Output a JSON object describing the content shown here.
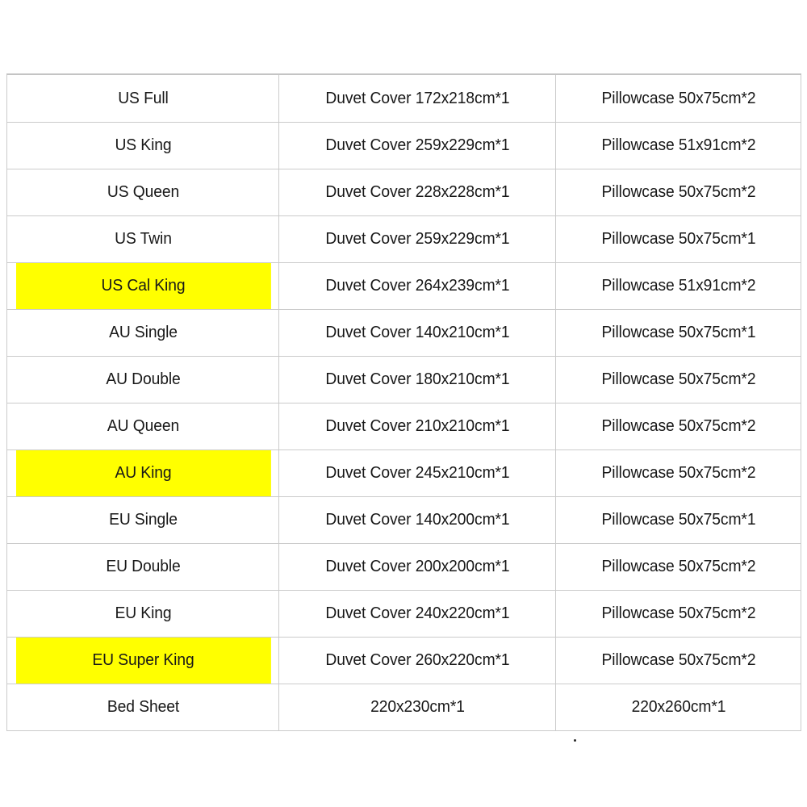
{
  "table": {
    "name": "bedding-size-chart",
    "highlight_color": "#ffff00",
    "border_color": "#cbcbcb",
    "text_color": "#181818",
    "columns": [
      "size",
      "duvet_cover",
      "pillowcase"
    ],
    "rows": [
      {
        "size": "US Full",
        "duvet_cover": "Duvet Cover 172x218cm*1",
        "pillowcase": "Pillowcase 50x75cm*2",
        "highlighted": false
      },
      {
        "size": "US King",
        "duvet_cover": "Duvet Cover 259x229cm*1",
        "pillowcase": "Pillowcase 51x91cm*2",
        "highlighted": false
      },
      {
        "size": "US Queen",
        "duvet_cover": "Duvet Cover 228x228cm*1",
        "pillowcase": "Pillowcase 50x75cm*2",
        "highlighted": false
      },
      {
        "size": "US Twin",
        "duvet_cover": "Duvet Cover 259x229cm*1",
        "pillowcase": "Pillowcase 50x75cm*1",
        "highlighted": false
      },
      {
        "size": "US Cal King",
        "duvet_cover": "Duvet Cover 264x239cm*1",
        "pillowcase": "Pillowcase 51x91cm*2",
        "highlighted": true
      },
      {
        "size": "AU Single",
        "duvet_cover": "Duvet Cover 140x210cm*1",
        "pillowcase": "Pillowcase 50x75cm*1",
        "highlighted": false
      },
      {
        "size": "AU Double",
        "duvet_cover": "Duvet Cover 180x210cm*1",
        "pillowcase": "Pillowcase 50x75cm*2",
        "highlighted": false
      },
      {
        "size": "AU Queen",
        "duvet_cover": "Duvet Cover 210x210cm*1",
        "pillowcase": "Pillowcase 50x75cm*2",
        "highlighted": false
      },
      {
        "size": "AU King",
        "duvet_cover": "Duvet Cover 245x210cm*1",
        "pillowcase": "Pillowcase 50x75cm*2",
        "highlighted": true
      },
      {
        "size": "EU Single",
        "duvet_cover": "Duvet Cover 140x200cm*1",
        "pillowcase": "Pillowcase 50x75cm*1",
        "highlighted": false
      },
      {
        "size": "EU Double",
        "duvet_cover": "Duvet Cover 200x200cm*1",
        "pillowcase": "Pillowcase 50x75cm*2",
        "highlighted": false
      },
      {
        "size": "EU King",
        "duvet_cover": "Duvet Cover 240x220cm*1",
        "pillowcase": "Pillowcase 50x75cm*2",
        "highlighted": false
      },
      {
        "size": "EU Super King",
        "duvet_cover": "Duvet Cover 260x220cm*1",
        "pillowcase": "Pillowcase 50x75cm*2",
        "highlighted": true
      },
      {
        "size": "Bed Sheet",
        "duvet_cover": "220x230cm*1",
        "pillowcase": "220x260cm*1",
        "highlighted": false
      }
    ]
  }
}
